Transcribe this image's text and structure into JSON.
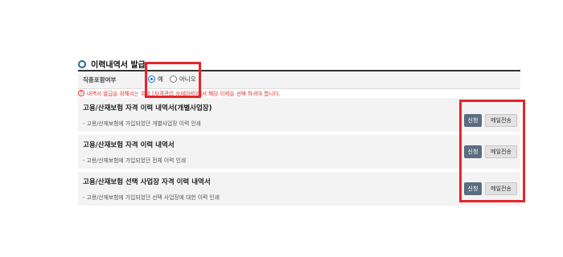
{
  "section": {
    "title": "이력내역서 발급"
  },
  "option": {
    "label": "직종포함여부",
    "choices": [
      {
        "label": "예",
        "selected": true
      },
      {
        "label": "아니오",
        "selected": false
      }
    ]
  },
  "notice": {
    "text": "내역서 발급을 위해서는 위의 [자격관리 상세이력]에서 해당 이력을 선택 하셔야 합니다."
  },
  "cards": [
    {
      "title": "고용/산재보험 자격 이력 내역서(개별사업장)",
      "description": "- 고용/산재보험에 가입되었던 개별사업장 이력 인쇄",
      "apply_label": "신청",
      "mail_label": "메일전송"
    },
    {
      "title": "고용/산재보험 자격 이력 내역서",
      "description": "- 고용/산재보험에 가입되었던 전체 이력 인쇄",
      "apply_label": "신청",
      "mail_label": "메일전송"
    },
    {
      "title": "고용/산재보험 선택 사업장 자격 이력 내역서",
      "description": "- 고용/산재보험에 가입되었던 선택 사업장에 대한 이력 인쇄",
      "apply_label": "신청",
      "mail_label": "메일전송"
    }
  ],
  "colors": {
    "highlight": "#e3262a",
    "notice": "#e0302e",
    "apply_button": "#5c6d80",
    "radio_accent": "#1a74b8"
  }
}
